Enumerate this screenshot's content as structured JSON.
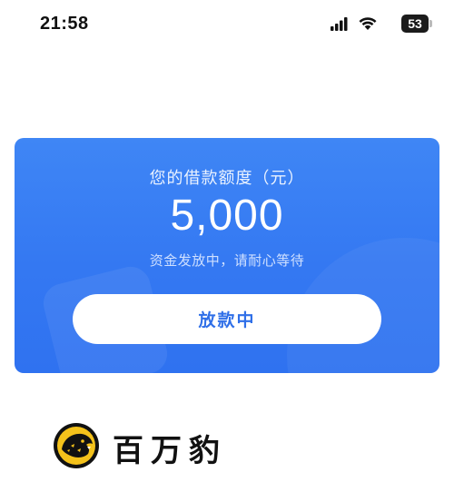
{
  "status_bar": {
    "time": "21:58",
    "battery_level": "53",
    "icons": [
      "signal-icon",
      "wifi-icon",
      "battery-icon"
    ]
  },
  "loan_card": {
    "title": "您的借款额度（元）",
    "amount": "5,000",
    "subtitle": "资金发放中，请耐心等待",
    "button_label": "放款中",
    "colors": {
      "card": "#3478f2",
      "button_text": "#2f6fe8"
    }
  },
  "brand": {
    "name": "百万豹",
    "logo_icon": "leopard-logo-icon",
    "colors": {
      "logo_bg": "#f4c21b",
      "logo_fg": "#111111"
    }
  }
}
